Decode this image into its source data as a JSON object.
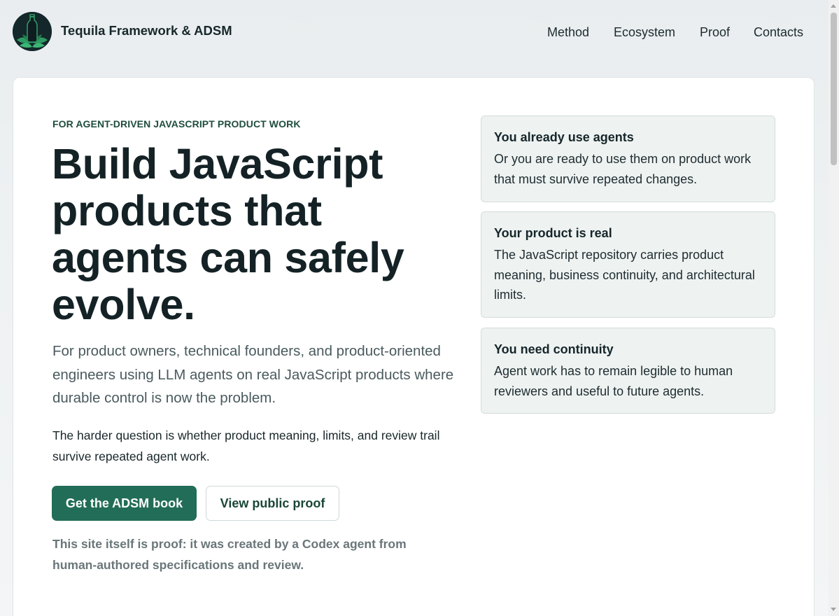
{
  "header": {
    "brand": "Tequila Framework & ADSM",
    "logo_icon": "tequila-bottle-agave-logo",
    "nav": [
      {
        "label": "Method"
      },
      {
        "label": "Ecosystem"
      },
      {
        "label": "Proof"
      },
      {
        "label": "Contacts"
      }
    ]
  },
  "hero": {
    "eyebrow": "FOR AGENT-DRIVEN JAVASCRIPT PRODUCT WORK",
    "headline": "Build JavaScript products that agents can safely evolve.",
    "lead": "For product owners, technical founders, and product-oriented engineers using LLM agents on real JavaScript products where durable control is now the problem.",
    "sub": "The harder question is whether product meaning, limits, and review trail survive repeated agent work.",
    "primary_button": "Get the ADSM book",
    "secondary_button": "View public proof",
    "note": "This site itself is proof: it was created by a Codex agent from human-authored specifications and review."
  },
  "panels": [
    {
      "title": "You already use agents",
      "body": "Or you are ready to use them on product work that must survive repeated changes."
    },
    {
      "title": "Your product is real",
      "body": "The JavaScript repository carries product meaning, business continuity, and architectural limits."
    },
    {
      "title": "You need continuity",
      "body": "Agent work has to remain legible to human reviewers and useful to future agents."
    }
  ],
  "colors": {
    "accent": "#226d57",
    "eyebrow": "#1f4d3e",
    "heading": "#142226",
    "panel_bg": "#eef2f1"
  }
}
